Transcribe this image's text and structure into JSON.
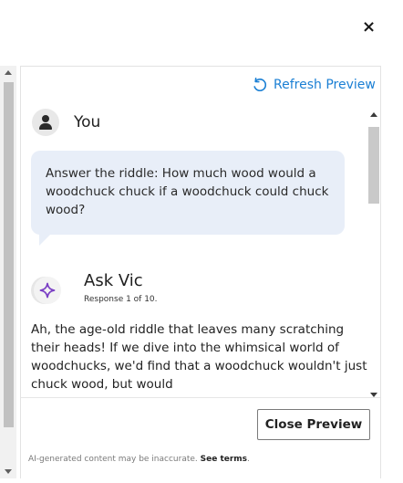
{
  "dialog": {
    "close_glyph": "×",
    "close_icon": "close-icon"
  },
  "header": {
    "refresh_label": "Refresh Preview",
    "refresh_icon": "refresh-icon"
  },
  "user": {
    "name": "You",
    "avatar_icon": "user-icon",
    "message": "Answer the riddle: How much wood would a woodchuck chuck if a woodchuck could chuck wood?"
  },
  "assistant": {
    "name": "Ask Vic",
    "avatar_icon": "sparkle-icon",
    "response_counter": "Response 1 of 10.",
    "message": "Ah, the age-old riddle that leaves many scratching their heads! If we dive into the whimsical world of woodchucks, we'd find that a woodchuck wouldn't just chuck wood, but would"
  },
  "footer": {
    "close_preview_label": "Close Preview",
    "disclaimer_text": "AI-generated content may be inaccurate.",
    "terms_link": "See terms",
    "terms_suffix": "."
  },
  "colors": {
    "accent": "#1a7fd4",
    "bubble": "#e8eef8",
    "sparkle": "#7a3fc4"
  }
}
